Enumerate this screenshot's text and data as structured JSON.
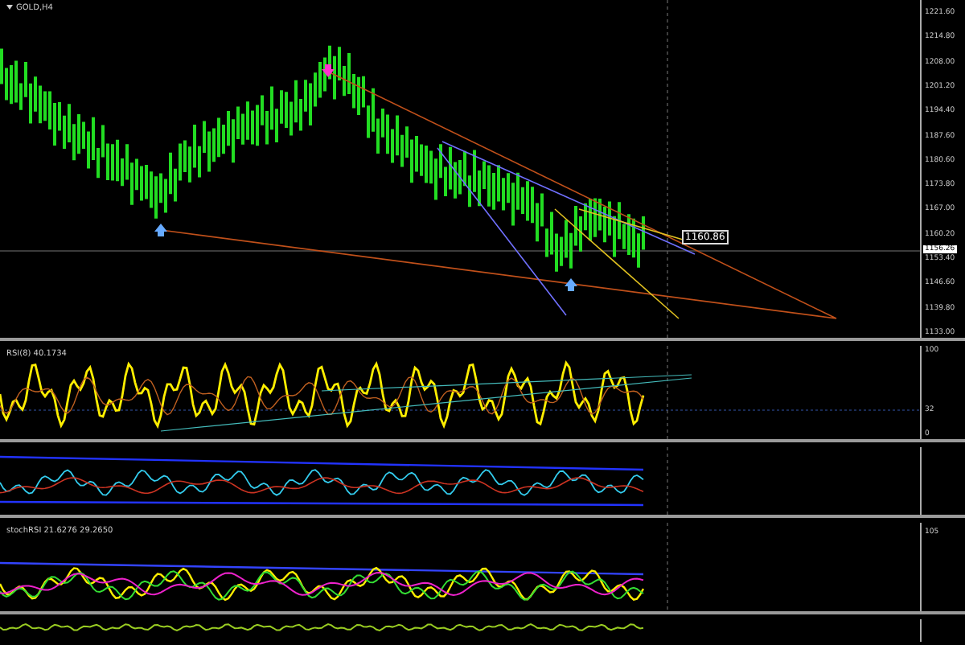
{
  "symbol": "GOLD,H4",
  "price_axis": [
    "1221.60",
    "1214.80",
    "1208.00",
    "1201.20",
    "1194.40",
    "1187.60",
    "1180.60",
    "1173.80",
    "1167.00",
    "1160.20",
    "1153.40",
    "1146.60",
    "1139.80",
    "1133.00"
  ],
  "current_price": "1156.26",
  "trendline_label": "1160.86",
  "rsi": {
    "label": "RSI(8) 40.1734",
    "axis": [
      "100",
      "32",
      "0"
    ]
  },
  "stoch_rsi": {
    "label": "stochRSI 21.6276 29.2650",
    "axis": [
      "105"
    ]
  }
}
